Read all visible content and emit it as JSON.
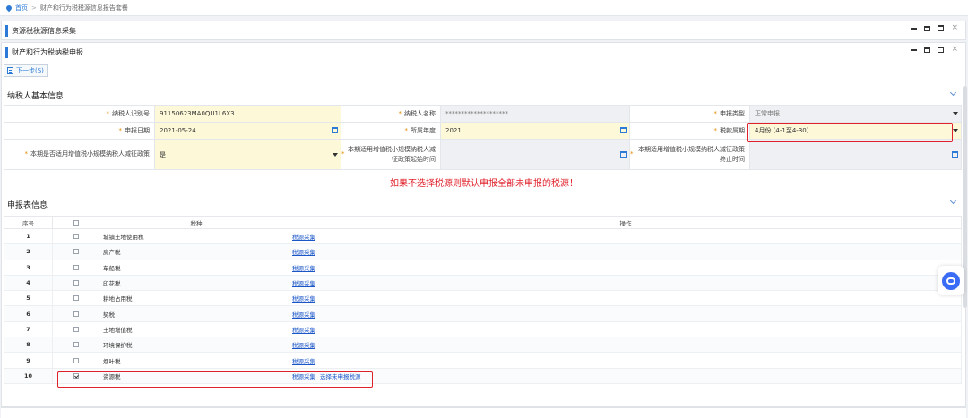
{
  "breadcrumb": {
    "home": "首页",
    "separator": ">",
    "current": "财产和行为税税源信息报告套餐"
  },
  "panels": {
    "outer_title": "资源税税源信息采集",
    "inner_title": "财产和行为税纳税申报"
  },
  "toolbar": {
    "next_label": "下一步(S)"
  },
  "basic_info": {
    "title": "纳税人基本信息",
    "taxpayer_id_label": "纳税人识别号",
    "taxpayer_id_value": "91150623MA0QU1L6X3",
    "taxpayer_name_label": "纳税人名称",
    "taxpayer_name_value": "********************",
    "report_type_label": "申报类型",
    "report_type_value": "正常申报",
    "report_date_label": "申报日期",
    "report_date_value": "2021-05-24",
    "year_label": "所属年度",
    "year_value": "2021",
    "period_label": "税款属期",
    "period_value": "4月份 (4-1至4-30)",
    "policy_label": "本期是否适用增值税小规模纳税人减征政策",
    "policy_value": "是",
    "start_label": "本期适用增值税小规模纳税人减征政策起始时间",
    "end_label": "本期适用增值税小规模纳税人减征政策终止时间",
    "required_mark": "*"
  },
  "warning": "如果不选择税源则默认申报全部未申报的税源！",
  "report_table": {
    "title": "申报表信息",
    "headers": {
      "no": "序号",
      "tax": "税种",
      "op": "操作"
    },
    "rows": [
      {
        "no": "1",
        "tax": "城镇土地使用税",
        "links": [
          "税源采集"
        ],
        "checked": false
      },
      {
        "no": "2",
        "tax": "房产税",
        "links": [
          "税源采集"
        ],
        "checked": false
      },
      {
        "no": "3",
        "tax": "车船税",
        "links": [
          "税源采集"
        ],
        "checked": false
      },
      {
        "no": "4",
        "tax": "印花税",
        "links": [
          "税源采集"
        ],
        "checked": false
      },
      {
        "no": "5",
        "tax": "耕地占用税",
        "links": [
          "税源采集"
        ],
        "checked": false
      },
      {
        "no": "6",
        "tax": "契税",
        "links": [
          "税源采集"
        ],
        "checked": false
      },
      {
        "no": "7",
        "tax": "土地增值税",
        "links": [
          "税源采集"
        ],
        "checked": false
      },
      {
        "no": "8",
        "tax": "环境保护税",
        "links": [
          "税源采集"
        ],
        "checked": false
      },
      {
        "no": "9",
        "tax": "烟叶税",
        "links": [
          "税源采集"
        ],
        "checked": false
      },
      {
        "no": "10",
        "tax": "资源税",
        "links": [
          "税源采集",
          "选择未申报税源"
        ],
        "checked": true
      }
    ]
  },
  "colors": {
    "accent": "#2d7ad6",
    "highlight": "#e0202a",
    "link": "#1a56c8"
  },
  "icons": {
    "home": "location-pin-icon",
    "calendar": "calendar-icon",
    "chat": "chat-icon"
  }
}
